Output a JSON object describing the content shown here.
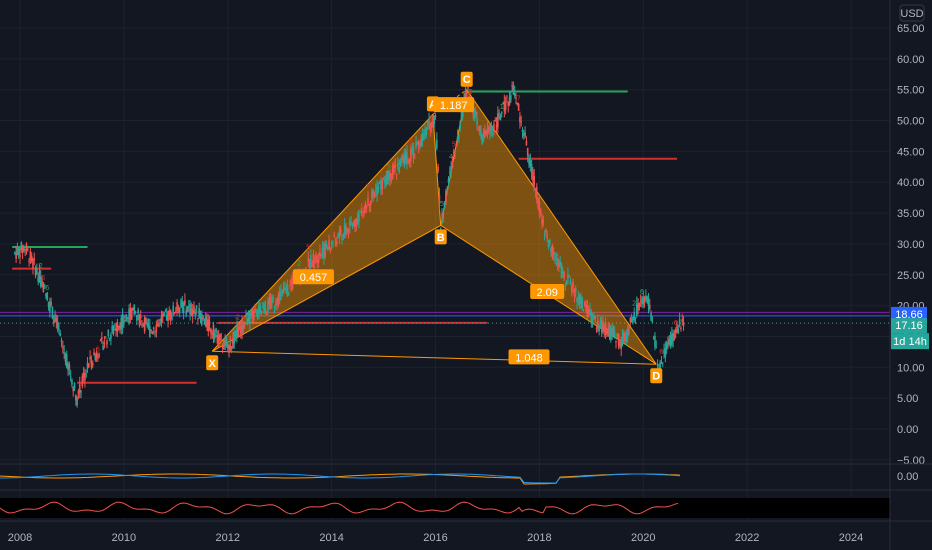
{
  "currency": "USD",
  "chart_data": {
    "type": "candlestick",
    "y_axis": {
      "ylim": [
        -6,
        68
      ],
      "ticks": [
        "65.00",
        "60.00",
        "55.00",
        "50.00",
        "45.00",
        "40.00",
        "35.00",
        "30.00",
        "25.00",
        "20.00",
        "15.00",
        "10.00",
        "5.00",
        "0.00",
        "−5.00"
      ]
    },
    "x_axis": {
      "xlim": [
        2007.85,
        2025.0
      ],
      "ticks": [
        "2008",
        "2010",
        "2012",
        "2014",
        "2016",
        "2018",
        "2020",
        "2022",
        "2024"
      ]
    },
    "price_series": [
      [
        2007.9,
        28.5
      ],
      [
        2008.1,
        29.5
      ],
      [
        2008.3,
        26
      ],
      [
        2008.5,
        22
      ],
      [
        2008.7,
        17
      ],
      [
        2008.9,
        11
      ],
      [
        2009.1,
        5
      ],
      [
        2009.3,
        10
      ],
      [
        2009.6,
        14
      ],
      [
        2009.9,
        17
      ],
      [
        2010.2,
        19
      ],
      [
        2010.5,
        16
      ],
      [
        2010.8,
        18
      ],
      [
        2011.1,
        20
      ],
      [
        2011.4,
        19
      ],
      [
        2011.7,
        16
      ],
      [
        2012.0,
        13
      ],
      [
        2012.4,
        18
      ],
      [
        2012.8,
        20
      ],
      [
        2013.2,
        23
      ],
      [
        2013.6,
        27
      ],
      [
        2014.0,
        30
      ],
      [
        2014.4,
        33
      ],
      [
        2014.8,
        38
      ],
      [
        2015.2,
        42
      ],
      [
        2015.6,
        45
      ],
      [
        2016.0,
        51
      ],
      [
        2016.1,
        33
      ],
      [
        2016.3,
        42
      ],
      [
        2016.6,
        55
      ],
      [
        2016.9,
        47
      ],
      [
        2017.2,
        50
      ],
      [
        2017.5,
        55
      ],
      [
        2017.7,
        48
      ],
      [
        2017.9,
        40
      ],
      [
        2018.1,
        32
      ],
      [
        2018.4,
        26
      ],
      [
        2018.7,
        22
      ],
      [
        2019.0,
        18
      ],
      [
        2019.3,
        16
      ],
      [
        2019.6,
        14
      ],
      [
        2019.9,
        20
      ],
      [
        2020.1,
        21
      ],
      [
        2020.3,
        10
      ],
      [
        2020.5,
        14
      ],
      [
        2020.8,
        18
      ]
    ],
    "pattern": {
      "points": [
        {
          "label": "X",
          "x": 2011.7,
          "y": 12.6
        },
        {
          "label": "A",
          "x": 2015.95,
          "y": 51.0
        },
        {
          "label": "B",
          "x": 2016.1,
          "y": 33.0
        },
        {
          "label": "C",
          "x": 2016.6,
          "y": 55.0
        },
        {
          "label": "D",
          "x": 2020.25,
          "y": 10.5
        }
      ],
      "ratios": [
        {
          "text": "0.457",
          "x": 2013.65,
          "y": 24.6
        },
        {
          "text": "1.187",
          "x": 2016.35,
          "y": 52.5
        },
        {
          "text": "2.09",
          "x": 2018.15,
          "y": 22.2
        },
        {
          "text": "1.048",
          "x": 2017.8,
          "y": 11.6
        }
      ]
    },
    "levels": [
      {
        "y": 29.5,
        "x1": 2007.85,
        "x2": 2009.3,
        "color": "#26a65b"
      },
      {
        "y": 26.0,
        "x1": 2007.85,
        "x2": 2008.6,
        "color": "#d32f2f"
      },
      {
        "y": 7.5,
        "x1": 2009.1,
        "x2": 2011.4,
        "color": "#d32f2f"
      },
      {
        "y": 17.2,
        "x1": 2011.8,
        "x2": 2017.0,
        "color": "#d32f2f"
      },
      {
        "y": 54.7,
        "x1": 2016.6,
        "x2": 2019.7,
        "color": "#26a65b"
      },
      {
        "y": 43.8,
        "x1": 2017.6,
        "x2": 2020.65,
        "color": "#d32f2f"
      }
    ],
    "hline_blue": 18.66,
    "hline_purple": 18.9,
    "last_price_dotted": 17.16,
    "price_tags": [
      {
        "text": "18.66",
        "y": 18.66,
        "color": "#2962ff"
      },
      {
        "text": "17.16",
        "y": 17.16,
        "color": "#26a69a"
      }
    ]
  },
  "countdown": "1d 14h",
  "indicator1": {
    "label": "0.00"
  }
}
